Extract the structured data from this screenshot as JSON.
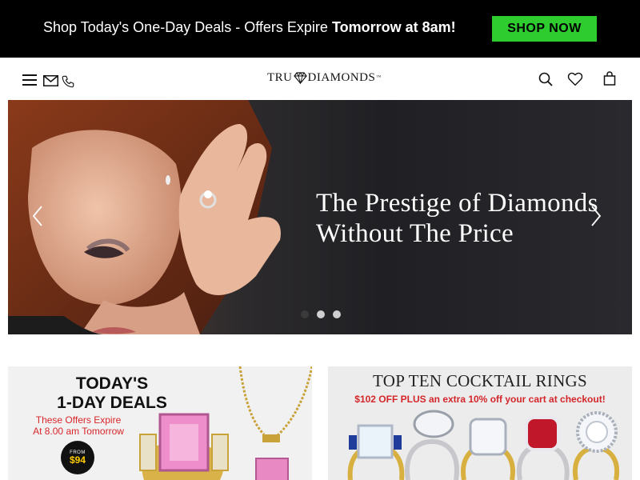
{
  "promo_bar": {
    "message": "Shop Today's One-Day Deals - Offers Expire ",
    "message_bold": "Tomorrow at 8am!",
    "cta_label": "SHOP NOW",
    "background": "#000000",
    "cta_color": "#2ecc2e"
  },
  "header": {
    "logo_left": "TRU",
    "logo_right": "DIAMONDS",
    "logo_tm": "™",
    "left_icons": [
      "menu-icon",
      "mail-icon",
      "phone-icon"
    ],
    "right_icons": [
      "search-icon",
      "heart-icon",
      "shopping-bag-icon"
    ]
  },
  "hero": {
    "title_line1": "The Prestige of Diamonds",
    "title_line2": "Without The Price",
    "slide_count": 3,
    "active_slide": 1
  },
  "tiles": {
    "deals": {
      "title_line1": "TODAY'S",
      "title_line2": "1-DAY DEALS",
      "subtitle_line1": "These Offers Expire",
      "subtitle_line2": "At 8.00 am Tomorrow",
      "badge_from": "FROM",
      "badge_price": "$94"
    },
    "rings": {
      "title": "TOP TEN COCKTAIL RINGS",
      "subtitle": "$102 OFF PLUS an extra 10% off your cart at checkout!"
    }
  }
}
